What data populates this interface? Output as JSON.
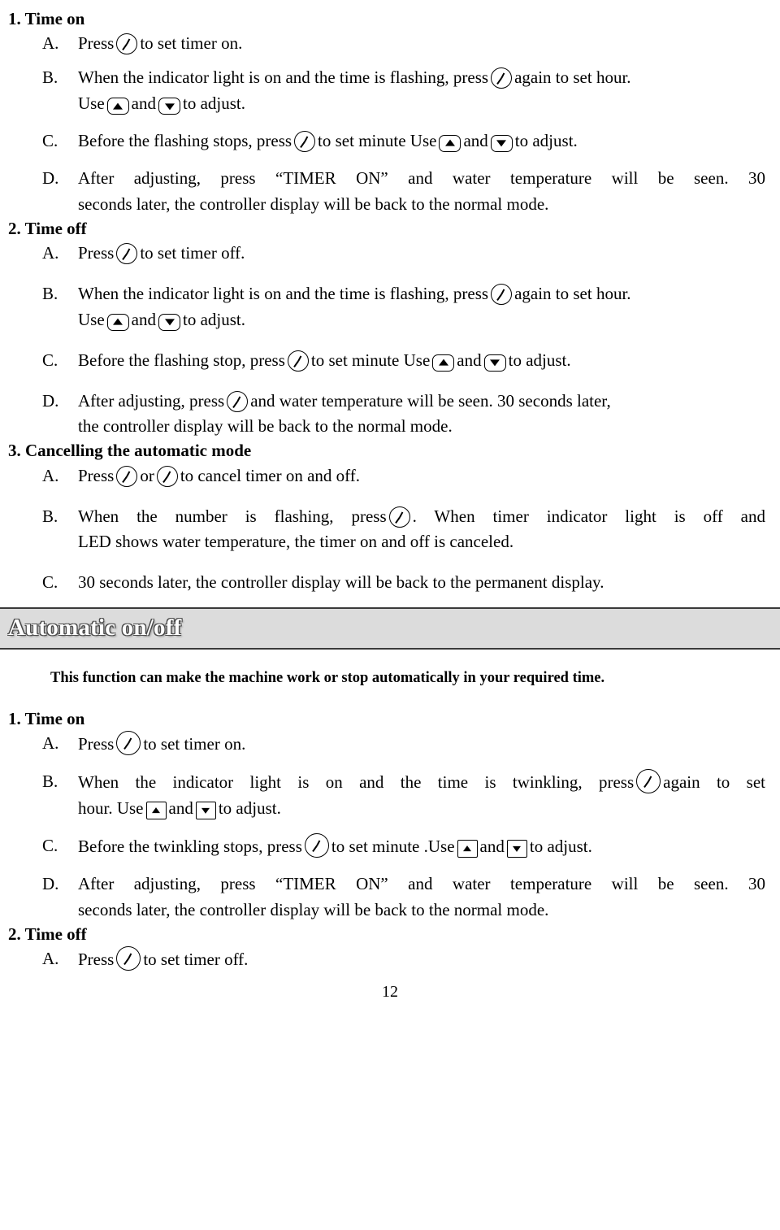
{
  "page_number": "12",
  "section1": {
    "heading": "1. Time on",
    "items": [
      {
        "marker": "A.",
        "text_before": "Press",
        "icon": "timer-clock-icon",
        "text_after": "to set timer on."
      },
      {
        "marker": "B.",
        "line1_a": "When the indicator light is on and the time is flashing, press",
        "line1_icon": "timer-clock-icon",
        "line1_b": "again to set hour.",
        "line2_a": "Use",
        "line2_icon1": "up-arrow-icon",
        "line2_b": "and",
        "line2_icon2": "down-arrow-icon",
        "line2_c": "to adjust."
      },
      {
        "marker": "C.",
        "a": "Before the flashing stops, press",
        "icon1": "timer-clock-icon",
        "b": "to set minute Use",
        "icon2": "up-arrow-icon",
        "c": "and",
        "icon3": "down-arrow-icon",
        "d": "to adjust."
      },
      {
        "marker": "D.",
        "line1": "After adjusting, press “TIMER ON” and water temperature will be seen. 30",
        "line2": "seconds later, the controller display will be back to the normal mode."
      }
    ]
  },
  "section2": {
    "heading": "2. Time off",
    "items": [
      {
        "marker": "A.",
        "text_before": "Press",
        "icon": "timer-clock-icon",
        "text_after": "to set timer off."
      },
      {
        "marker": "B.",
        "line1_a": "When the indicator light is on and the time is flashing, press",
        "line1_icon": "timer-clock-icon",
        "line1_b": "again to set hour.",
        "line2_a": "Use",
        "line2_icon1": "up-arrow-icon",
        "line2_b": "and",
        "line2_icon2": "down-arrow-icon",
        "line2_c": "to adjust."
      },
      {
        "marker": "C.",
        "a": "Before the flashing stop, press",
        "icon1": "timer-clock-icon",
        "b": "to set minute Use",
        "icon2": "up-arrow-icon",
        "c": "and",
        "icon3": "down-arrow-icon",
        "d": "to adjust."
      },
      {
        "marker": "D.",
        "a": "After adjusting, press",
        "icon1": "timer-clock-icon",
        "b": "and water temperature will be seen. 30 seconds later,",
        "line2": "the controller display will be back to the normal mode."
      }
    ]
  },
  "section3": {
    "heading": "3. Cancelling the automatic mode",
    "items": [
      {
        "marker": "A.",
        "a": "Press",
        "icon1": "timer-clock-icon",
        "b": "or",
        "icon2": "timer-clock-icon",
        "c": "to cancel timer on and off."
      },
      {
        "marker": "B.",
        "a": "When the number is flashing, press",
        "icon1": "timer-clock-icon",
        "b": ". When timer indicator light is off and",
        "line2": "LED shows water temperature, the timer on and off is canceled."
      },
      {
        "marker": "C.",
        "a": "30 seconds later, the controller display will be back to the permanent display."
      }
    ]
  },
  "banner": {
    "title": "Automatic on/off"
  },
  "intro": {
    "text": "This function can make the machine work or stop automatically in your required time."
  },
  "section4": {
    "heading": "1. Time on",
    "items": [
      {
        "marker": "A.",
        "text_before": "Press",
        "icon": "timer-clock-icon",
        "text_after": "to set timer on."
      },
      {
        "marker": "B.",
        "line1_a": "When the indicator light is on and the time is twinkling, press",
        "line1_icon": "timer-clock-icon",
        "line1_b": "again to set",
        "line2_a": "hour. Use",
        "line2_icon1": "up-arrow-icon",
        "line2_b": "and",
        "line2_icon2": "down-arrow-icon",
        "line2_c": "to adjust."
      },
      {
        "marker": "C.",
        "a": "Before the twinkling stops, press",
        "icon1": "timer-clock-icon",
        "b": "to set minute .Use",
        "icon2": "up-arrow-icon",
        "c": "and",
        "icon3": "down-arrow-icon",
        "d": "to adjust."
      },
      {
        "marker": "D.",
        "line1": "After adjusting, press “TIMER ON” and water temperature will be seen. 30",
        "line2": "seconds later, the controller display will be back to the normal mode."
      }
    ]
  },
  "section5": {
    "heading": "2. Time off",
    "items": [
      {
        "marker": "A.",
        "text_before": "Press",
        "icon": "timer-clock-icon",
        "text_after": "to set timer off."
      }
    ]
  }
}
